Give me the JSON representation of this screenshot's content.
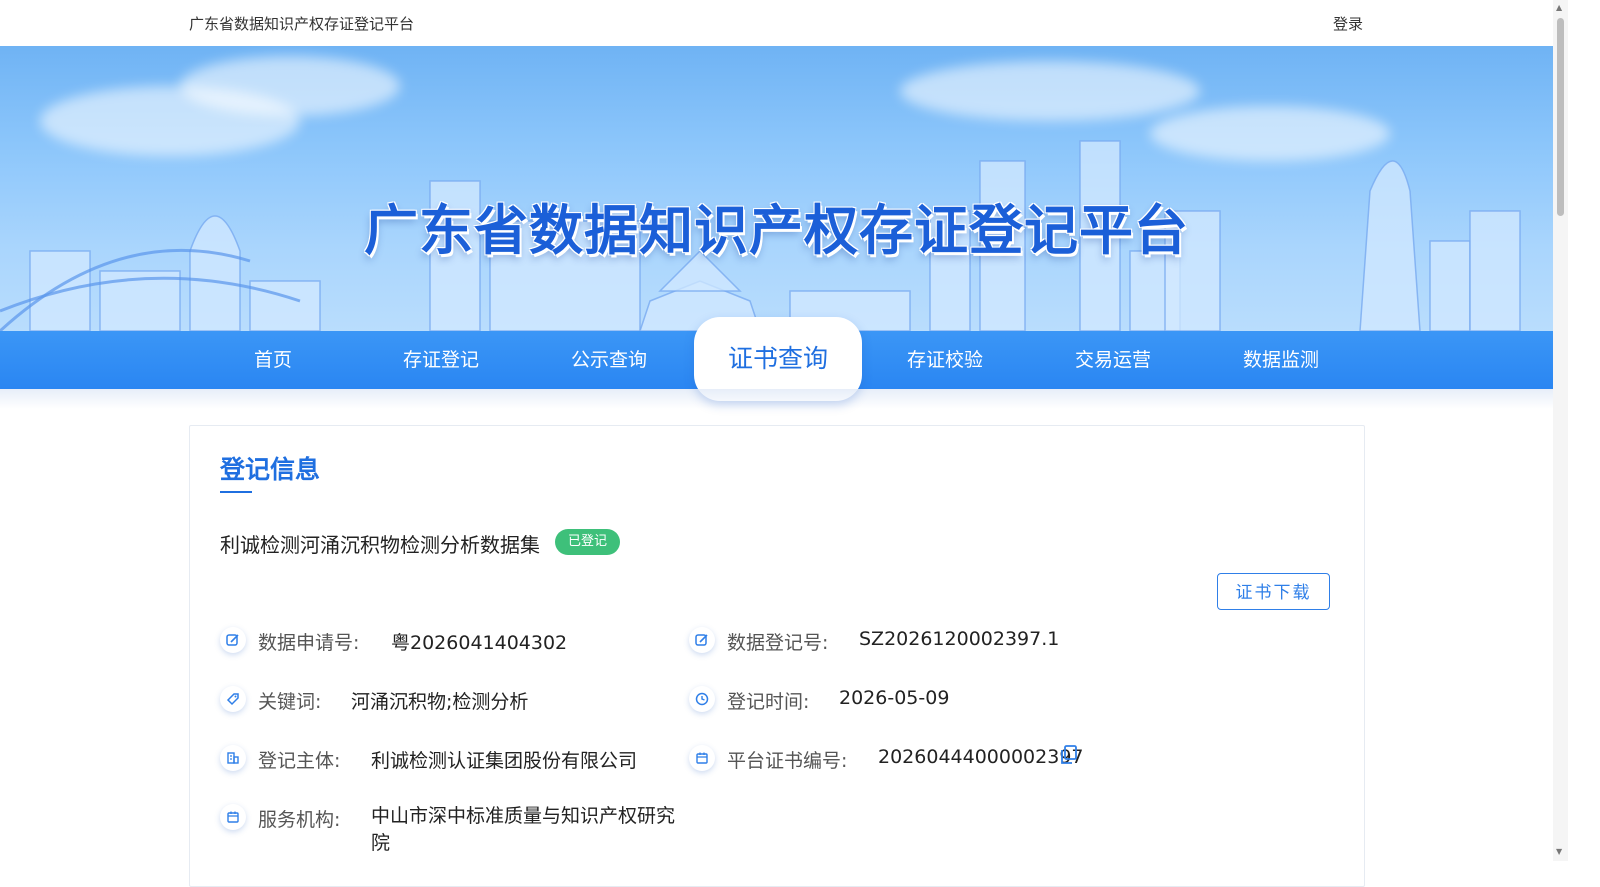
{
  "header": {
    "site_name": "广东省数据知识产权存证登记平台",
    "login_label": "登录"
  },
  "banner": {
    "title": "广东省数据知识产权存证登记平台"
  },
  "nav": {
    "items": [
      {
        "label": "首页",
        "active": false
      },
      {
        "label": "存证登记",
        "active": false
      },
      {
        "label": "公示查询",
        "active": false
      },
      {
        "label": "证书查询",
        "active": true
      },
      {
        "label": "存证校验",
        "active": false
      },
      {
        "label": "交易运营",
        "active": false
      },
      {
        "label": "数据监测",
        "active": false
      }
    ]
  },
  "registration": {
    "section_title": "登记信息",
    "dataset_name": "利诚检测河涌沉积物检测分析数据集",
    "status": "已登记",
    "download_label": "证书下载",
    "fields": {
      "application_no": {
        "label": "数据申请号:",
        "value": "粤2026041404302",
        "icon": "edit-icon"
      },
      "registration_no": {
        "label": "数据登记号:",
        "value": "SZ2026120002397.1",
        "icon": "edit-icon"
      },
      "keywords": {
        "label": "关键词:",
        "value": "河涌沉积物;检测分析",
        "icon": "tag-icon"
      },
      "registration_time": {
        "label": "登记时间:",
        "value": "2026-05-09",
        "icon": "clock-icon"
      },
      "registrant": {
        "label": "登记主体:",
        "value": "利诚检测认证集团股份有限公司",
        "icon": "building-icon"
      },
      "certificate_no": {
        "label": "平台证书编号:",
        "value": "20260444000002397",
        "icon": "calendar-icon"
      },
      "service_org": {
        "label": "服务机构:",
        "value": "中山市深中标准质量与知识产权研究院",
        "icon": "calendar-icon"
      }
    }
  },
  "colors": {
    "accent": "#1f6fe0",
    "nav_bg": "#2a86f2",
    "status_green": "#3ec07a"
  }
}
